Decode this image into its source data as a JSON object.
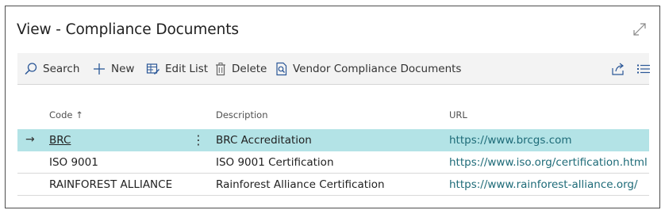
{
  "page": {
    "title": "View - Compliance Documents"
  },
  "toolbar": {
    "search_label": "Search",
    "new_label": "New",
    "edit_list_label": "Edit List",
    "delete_label": "Delete",
    "vendor_docs_label": "Vendor Compliance Documents"
  },
  "icons": {
    "expand": "expand-icon",
    "search": "search-icon",
    "new": "plus-icon",
    "edit_list": "edit-list-icon",
    "delete": "trash-icon",
    "vendor_docs": "document-search-icon",
    "share": "share-icon",
    "list_view": "list-view-icon"
  },
  "table": {
    "columns": {
      "code": "Code ↑",
      "description": "Description",
      "url": "URL"
    },
    "rows": [
      {
        "code": "BRC",
        "description": "BRC Accreditation",
        "url": "https://www.brcgs.com"
      },
      {
        "code": "ISO 9001",
        "description": "ISO 9001 Certification",
        "url": "https://www.iso.org/certification.html"
      },
      {
        "code": "RAINFOREST ALLIANCE",
        "description": "Rainforest Alliance Certification",
        "url": "https://www.rainforest-alliance.org/"
      }
    ],
    "selected_row_marker": "→",
    "row_menu_glyph": "⋮"
  },
  "colors": {
    "selected_row": "#b3e3e6",
    "link": "#1e6b78",
    "accent": "#2b5797"
  }
}
